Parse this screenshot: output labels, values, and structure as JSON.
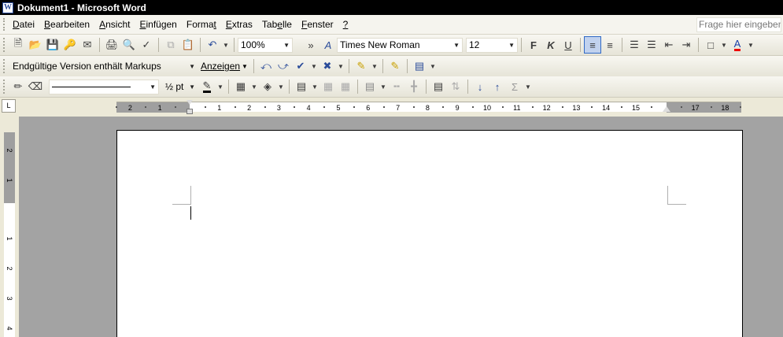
{
  "window": {
    "title": "Dokument1 - Microsoft Word",
    "app_icon": "W"
  },
  "menu": {
    "items": [
      {
        "u": "D",
        "rest": "atei"
      },
      {
        "u": "B",
        "rest": "earbeiten"
      },
      {
        "u": "A",
        "rest": "nsicht"
      },
      {
        "u": "E",
        "rest": "infügen"
      },
      {
        "pre": "Forma",
        "u": "t",
        "rest": ""
      },
      {
        "u": "E",
        "rest": "xtras"
      },
      {
        "pre": "Tab",
        "u": "e",
        "rest": "lle"
      },
      {
        "u": "F",
        "rest": "enster"
      },
      {
        "u": "?",
        "rest": ""
      }
    ],
    "help_placeholder": "Frage hier eingeben"
  },
  "standard_toolbar": {
    "zoom": "100%",
    "font_name": "Times New Roman",
    "font_size": "12",
    "bold": "F",
    "italic": "K",
    "underline": "U",
    "font_color_letter": "A",
    "expand_glyph": "»"
  },
  "reviewing_toolbar": {
    "display_mode": "Endgültige Version enthält Markups",
    "show_button": "Anzeigen"
  },
  "drawing_toolbar": {
    "line_weight": "½ pt",
    "sigma": "Σ"
  },
  "ruler": {
    "corner": "L",
    "h_labels": [
      "2",
      "1",
      "1",
      "2",
      "3",
      "4",
      "5",
      "6",
      "7",
      "8",
      "9",
      "10",
      "11",
      "12",
      "13",
      "14",
      "15",
      "17",
      "18"
    ],
    "v_labels": [
      "2",
      "1",
      "1",
      "2",
      "3",
      "4"
    ]
  }
}
